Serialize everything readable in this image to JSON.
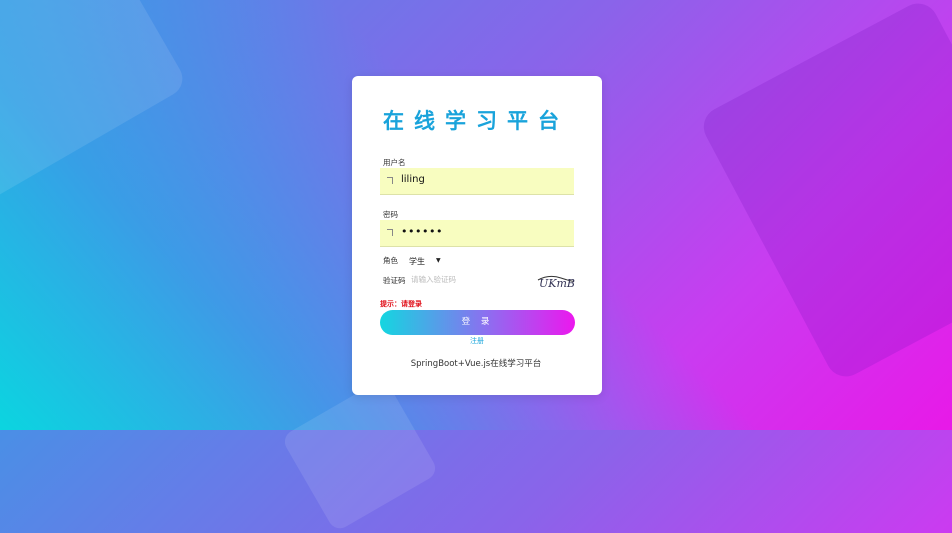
{
  "login": {
    "title": "在线学习平台",
    "username_label": "用户名",
    "username_value": "liling",
    "password_label": "密码",
    "password_value": "••••••",
    "role_label": "角色",
    "role_value": "学生",
    "captcha_label": "验证码",
    "captcha_placeholder": "请输入验证码",
    "captcha_image_text": "UKmB",
    "hint": "提示：请登录",
    "login_button": "登 录",
    "register_link": "注册",
    "footer": "SpringBoot+Vue.js在线学习平台"
  },
  "colors": {
    "title": "#19a3db",
    "input_bg": "#f8fdc0",
    "hint": "#e0101a",
    "button_gradient_start": "#14d6e0",
    "button_gradient_end": "#ec18ee"
  }
}
